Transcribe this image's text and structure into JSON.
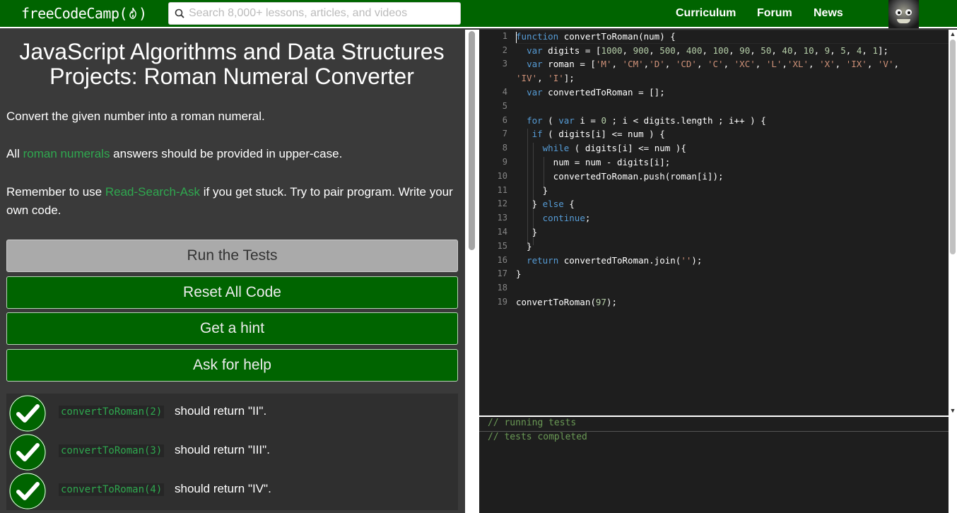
{
  "navbar": {
    "logo_text": "freeCodeCamp(",
    "logo_suffix": ")",
    "search_placeholder": "Search 8,000+ lessons, articles, and videos",
    "links": [
      "Curriculum",
      "Forum",
      "News"
    ],
    "brand_color": "#006400"
  },
  "challenge": {
    "title": "JavaScript Algorithms and Data Structures Projects: Roman Numeral Converter",
    "p1": "Convert the given number into a roman numeral.",
    "p2_pre": "All ",
    "p2_link": "roman numerals",
    "p2_post": " answers should be provided in upper-case.",
    "p3_pre": "Remember to use ",
    "p3_link": "Read-Search-Ask",
    "p3_post": " if you get stuck. Try to pair program. Write your own code."
  },
  "buttons": {
    "run": "Run the Tests",
    "reset": "Reset All Code",
    "hint": "Get a hint",
    "help": "Ask for help"
  },
  "tests": [
    {
      "code": "convertToRoman(2)",
      "text": "should return \"II\".",
      "status": "passed"
    },
    {
      "code": "convertToRoman(3)",
      "text": "should return \"III\".",
      "status": "passed"
    },
    {
      "code": "convertToRoman(4)",
      "text": "should return \"IV\".",
      "status": "passed"
    }
  ],
  "editor": {
    "line_numbers": [
      "1",
      "2",
      "3",
      "",
      "4",
      "5",
      "6",
      "7",
      "8",
      "9",
      "10",
      "11",
      "12",
      "13",
      "14",
      "15",
      "16",
      "17",
      "18",
      "19"
    ]
  },
  "output": {
    "lines": [
      "// running tests",
      "// tests completed"
    ]
  },
  "colors": {
    "link_green": "#2fa84f",
    "keyword_blue": "#569cd6",
    "comment_green": "#6a9955"
  }
}
